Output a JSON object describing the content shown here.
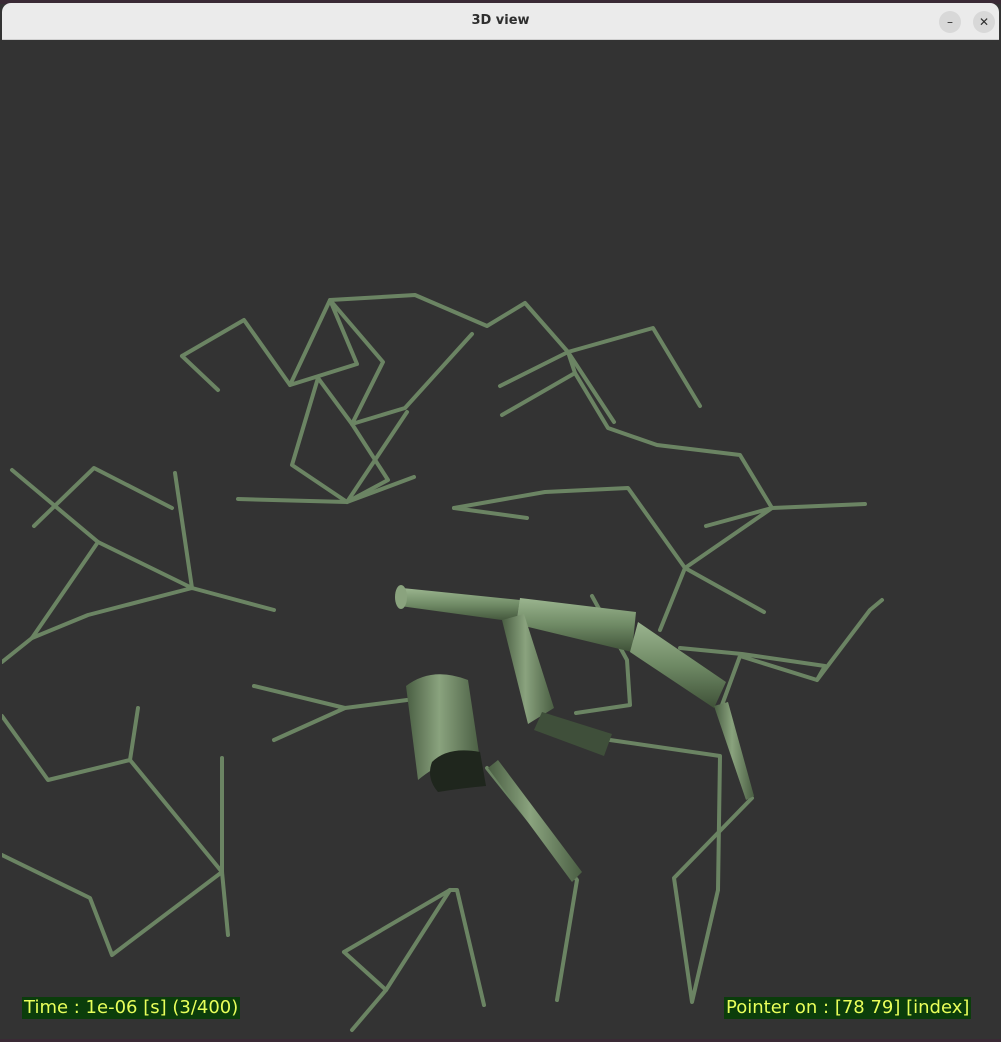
{
  "window": {
    "title": "3D view",
    "minimize_icon": "minimize-icon",
    "close_icon": "close-icon"
  },
  "viewport": {
    "background_color": "#333333",
    "trace_color": "#6b8463",
    "tube_color": "#7b9670",
    "time_label": "Time : 1e-06 [s] (3/400)",
    "pointer_label": "Pointer on : [78 79] [index]",
    "overlay_bg": "#0b3d0b",
    "overlay_fg": "#e8ff5a"
  }
}
